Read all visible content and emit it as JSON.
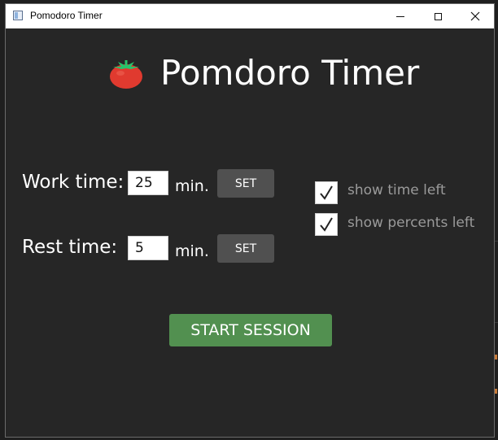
{
  "window": {
    "title": "Pomodoro Timer"
  },
  "header": {
    "title": "Pomdoro Timer",
    "icon": "tomato-icon"
  },
  "work": {
    "label": "Work time:",
    "value": "25",
    "unit": "min.",
    "set_label": "SET"
  },
  "rest": {
    "label": "Rest time:",
    "value": "5",
    "unit": "min.",
    "set_label": "SET"
  },
  "options": {
    "show_time_left": {
      "label": "show time left",
      "checked": true
    },
    "show_percents_left": {
      "label": "show percents left",
      "checked": true
    }
  },
  "actions": {
    "start_label": "START SESSION"
  },
  "colors": {
    "background": "#262626",
    "start_button": "#529050",
    "set_button": "#505050",
    "option_text": "#9a9a9a"
  }
}
